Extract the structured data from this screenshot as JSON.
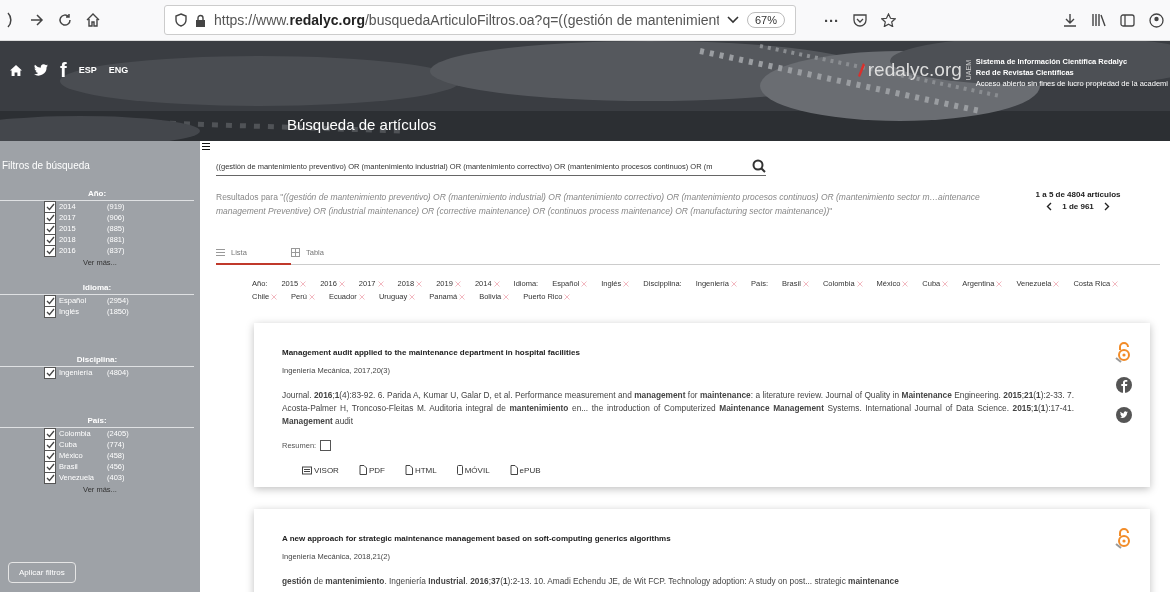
{
  "browser": {
    "url": "https://www.**redalyc.org**/busquedaArticuloFiltros.oa?q=((gestión de mantenimient",
    "zoom": "67%",
    "more": "···"
  },
  "header": {
    "languages": [
      "ESP",
      "ENG"
    ],
    "social_letter": "f",
    "logo": "redalyc.org",
    "logo_side": "UAEM",
    "tagline": [
      "Sistema de Información Científica Redalyc",
      "Red de Revistas Científicas",
      "Acceso abierto sin fines de lucro propiedad de la academi"
    ],
    "page_title": "Búsqueda de artículos"
  },
  "sidebar": {
    "title": "Filtros de búsqueda",
    "apply": "Aplicar filtros",
    "groups": [
      {
        "label": "Año:",
        "more": "Ver más...",
        "items": [
          {
            "name": "2014",
            "count": "(919)",
            "checked": true
          },
          {
            "name": "2017",
            "count": "(906)",
            "checked": true
          },
          {
            "name": "2015",
            "count": "(885)",
            "checked": true
          },
          {
            "name": "2018",
            "count": "(881)",
            "checked": true
          },
          {
            "name": "2016",
            "count": "(837)",
            "checked": true
          }
        ]
      },
      {
        "label": "Idioma:",
        "items": [
          {
            "name": "Español",
            "count": "(2954)",
            "checked": true
          },
          {
            "name": "Inglés",
            "count": "(1850)",
            "checked": true
          }
        ]
      },
      {
        "label": "Disciplina:",
        "items": [
          {
            "name": "Ingeniería",
            "count": "(4804)",
            "checked": true
          }
        ]
      },
      {
        "label": "País:",
        "more": "Ver más...",
        "items": [
          {
            "name": "Colombia",
            "count": "(2405)",
            "checked": true
          },
          {
            "name": "Cuba",
            "count": "(774)",
            "checked": true
          },
          {
            "name": "México",
            "count": "(458)",
            "checked": true
          },
          {
            "name": "Brasil",
            "count": "(456)",
            "checked": true
          },
          {
            "name": "Venezuela",
            "count": "(403)",
            "checked": true
          }
        ]
      }
    ]
  },
  "search": {
    "value": "((gestión de mantenimiento preventivo) OR (mantenimiento industrial) OR (mantenimiento correctivo) OR (mantenimiento procesos continuos) OR (m"
  },
  "results": {
    "text": "Resultados para \"*((gestión de mantenimiento preventivo) OR (mantenimiento industrial) OR (mantenimiento correctivo) OR (mantenimiento procesos continuos) OR (mantenimiento sector m…aintenance management Preventive) OR (industrial maintenance) OR (corrective maintenance) OR (continuos process maintenance) OR (manufacturing sector maintenance))*\"",
    "range": "1 a 5 de 4804 artículos",
    "page": "1 de 961"
  },
  "view_tabs": [
    {
      "label": "Lista",
      "kind": "list",
      "selected": true
    },
    {
      "label": "Tabla",
      "kind": "table",
      "selected": false
    }
  ],
  "active_filters": [
    {
      "label": "Año:",
      "values": [
        "2015",
        "2016",
        "2017",
        "2018",
        "2019",
        "2014"
      ]
    },
    {
      "label": "Idioma:",
      "values": [
        "Español",
        "Inglés"
      ]
    },
    {
      "label": "Discipplina:",
      "values": [
        "Ingeniería"
      ]
    },
    {
      "label": "País:",
      "values": [
        "Brasil",
        "Colombia",
        "México",
        "Cuba",
        "Argentina",
        "Venezuela",
        "Costa Rica",
        "Chile",
        "Perú",
        "Ecuador",
        "Uruguay",
        "Panamá",
        "Bolivia",
        "Puerto Rico"
      ]
    }
  ],
  "articles": [
    {
      "title": "Management audit applied to the maintenance department in hospital facilities",
      "source": "Ingeniería Mecánica, 2017,20(3)",
      "excerpt": "Journal. **2016**;**1**(4):83-92. 6. Parida A, Kumar U, Galar D, et al. Performance measurement and **management** for **maintenance**: a literature review. Journal of Quality in **Maintenance** Engineering. **2015**;**21**(**1**):2-33. 7. Acosta-Palmer H, Troncoso-Fleitas M. Auditoria integral de **mantenimiento** en... the introduction of Computerized **Maintenance Management** Systems. International Journal of Data Science. **2015**;**1**(**1**):17-41. **Management** audit",
      "summary_label": "Resumen:",
      "summary_checked": false,
      "share": true,
      "formats": [
        {
          "label": "VISOR",
          "kind": "viewer"
        },
        {
          "label": "PDF",
          "kind": "doc"
        },
        {
          "label": "HTML",
          "kind": "doc"
        },
        {
          "label": "MÓVIL",
          "kind": "mobile"
        },
        {
          "label": "ePUB",
          "kind": "doc"
        }
      ]
    },
    {
      "title": "A new approach for strategic maintenance management based on soft-computing generics algorithms",
      "source": "Ingeniería Mecánica, 2018,21(2)",
      "excerpt": "**gestión** de **mantenimiento**. Ingeniería **Industrial**. **2016**;**37**(**1**):2-13. 10. Amadi Echendu JE, de Wit FCP. Technology adoption: A study on post... strategic **maintenance**",
      "share": false
    }
  ]
}
